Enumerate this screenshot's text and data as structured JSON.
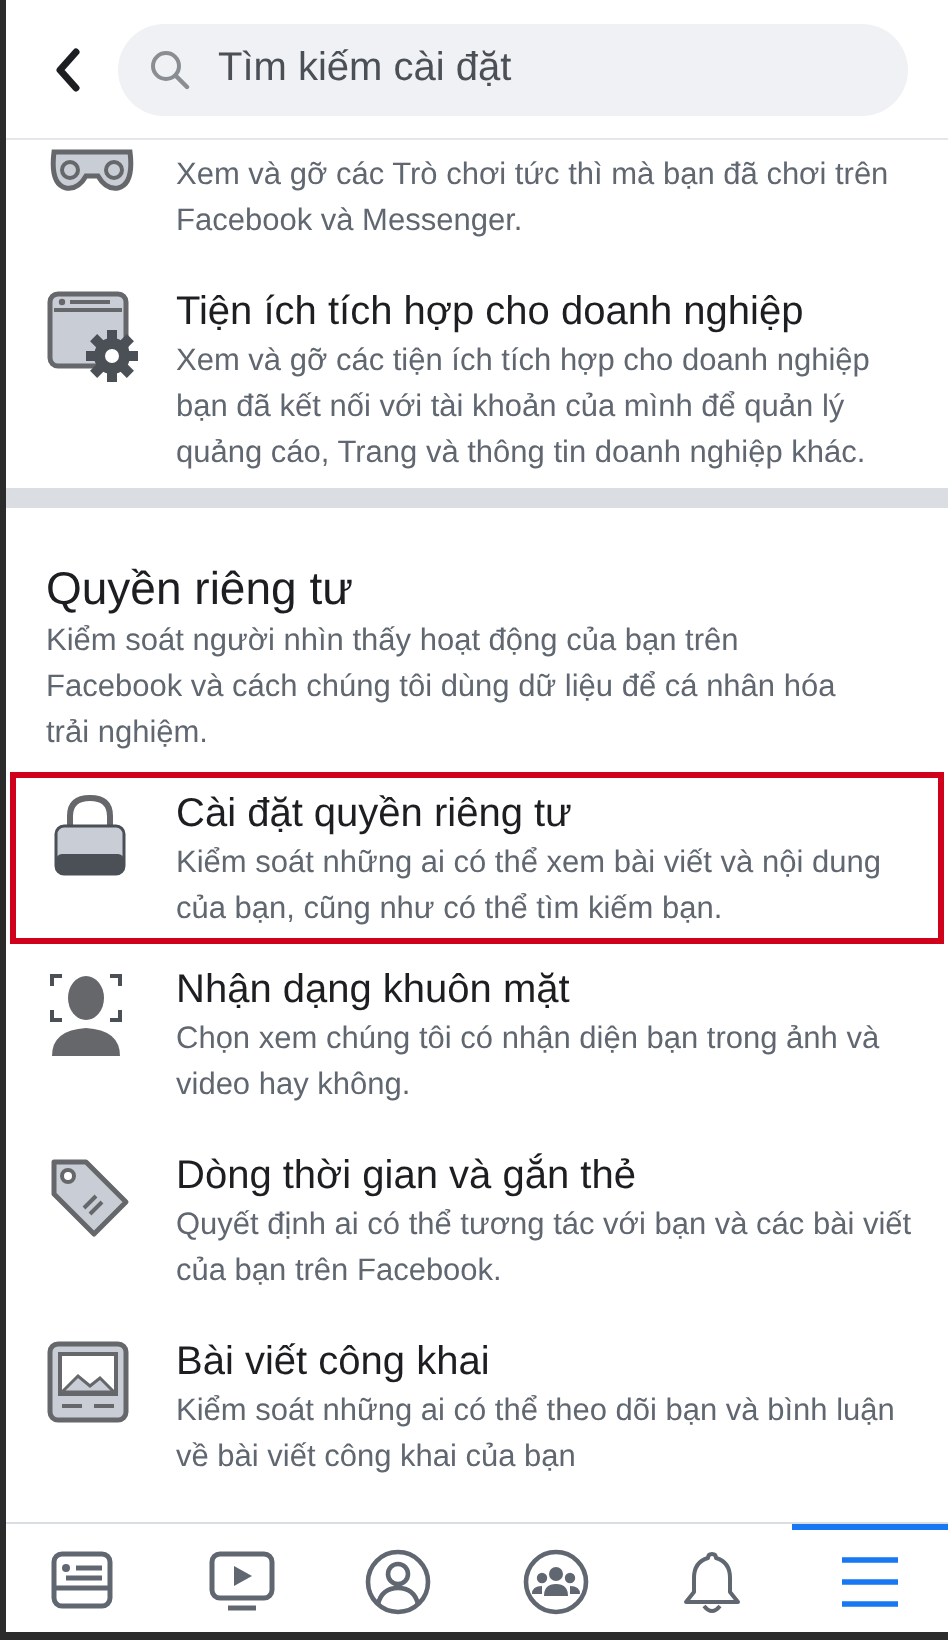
{
  "header": {
    "search": {
      "placeholder": "Tìm kiếm cài đặt"
    }
  },
  "sections": [
    {
      "items": [
        {
          "kind": "gamepad",
          "highlighted": false,
          "description": "Xem và gỡ các Trò chơi tức thì mà bạn đã chơi trên Facebook và Messenger."
        },
        {
          "kind": "gear-window",
          "highlighted": false,
          "title": "Tiện ích tích hợp cho doanh nghiệp",
          "description": "Xem và gỡ các tiện ích tích hợp cho doanh nghiệp bạn đã kết nối với tài khoản của mình để quản lý quảng cáo, Trang và thông tin doanh nghiệp khác."
        }
      ]
    },
    {
      "title": "Quyền riêng tư",
      "description": "Kiểm soát người nhìn thấy hoạt động của bạn trên Facebook và cách chúng tôi dùng dữ liệu để cá nhân hóa trải nghiệm.",
      "items": [
        {
          "kind": "lock",
          "highlighted": true,
          "title": "Cài đặt quyền riêng tư",
          "description": "Kiểm soát những ai có thể xem bài viết và nội dung của bạn, cũng như có thể tìm kiếm bạn."
        },
        {
          "kind": "face",
          "highlighted": false,
          "title": "Nhận dạng khuôn mặt",
          "description": "Chọn xem chúng tôi có nhận diện bạn trong ảnh và video hay không."
        },
        {
          "kind": "tag",
          "highlighted": false,
          "title": "Dòng thời gian và gắn thẻ",
          "description": "Quyết định ai có thể tương tác với bạn và các bài viết của bạn trên Facebook."
        },
        {
          "kind": "image",
          "highlighted": false,
          "title": "Bài viết công khai",
          "description": "Kiểm soát những ai có thể theo dõi bạn và bình luận về bài viết công khai của bạn"
        }
      ]
    }
  ],
  "bottom_nav": [
    {
      "kind": "feed",
      "selected": false
    },
    {
      "kind": "video",
      "selected": false
    },
    {
      "kind": "profile",
      "selected": false
    },
    {
      "kind": "groups",
      "selected": false
    },
    {
      "kind": "bell",
      "selected": false
    },
    {
      "kind": "menu",
      "selected": true
    }
  ]
}
